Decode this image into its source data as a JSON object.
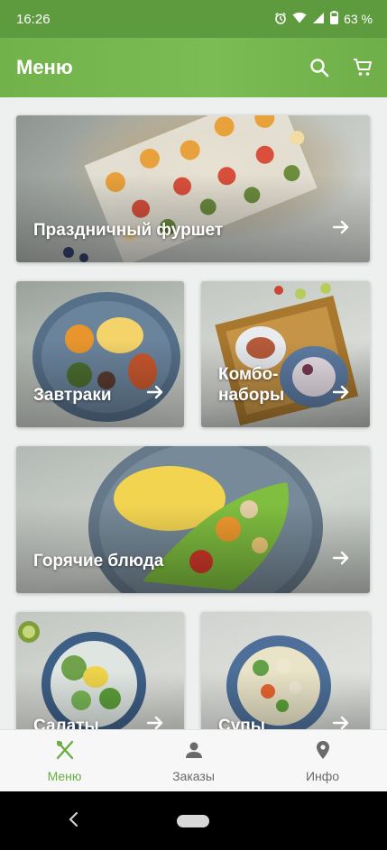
{
  "status_bar": {
    "time": "16:26",
    "battery": "63 %",
    "icons": [
      "alarm-icon",
      "wifi-icon",
      "signal-icon",
      "battery-icon"
    ]
  },
  "app_bar": {
    "title": "Меню",
    "actions": [
      "search-icon",
      "cart-icon"
    ]
  },
  "menu": {
    "categories": [
      {
        "label": "Праздничный фуршет"
      },
      {
        "label": "Завтраки"
      },
      {
        "label": "Комбо-наборы"
      },
      {
        "label": "Горячие блюда"
      },
      {
        "label": "Салаты"
      },
      {
        "label": "Супы"
      }
    ]
  },
  "bottom_nav": {
    "items": [
      {
        "label": "Меню",
        "icon": "fork-knife-icon",
        "active": true
      },
      {
        "label": "Заказы",
        "icon": "person-icon",
        "active": false
      },
      {
        "label": "Инфо",
        "icon": "location-pin-icon",
        "active": false
      }
    ]
  },
  "colors": {
    "accent": "#6aad40",
    "status_bar": "#5e9a3e"
  }
}
